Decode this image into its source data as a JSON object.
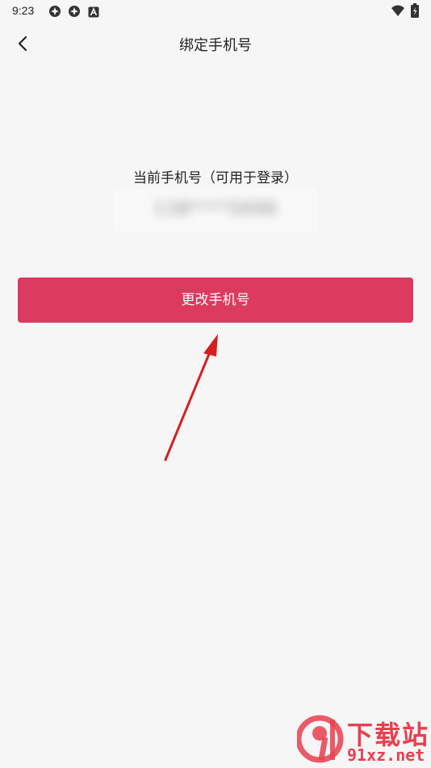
{
  "status_bar": {
    "time": "9:23",
    "icons": [
      "app-notification-icon",
      "app-notification-icon",
      "a-notification-icon",
      "wifi-icon",
      "battery-icon"
    ]
  },
  "nav": {
    "title": "绑定手机号",
    "back_icon": "chevron-left-icon"
  },
  "phone": {
    "label": "当前手机号（可用于登录）",
    "value": "138****5698"
  },
  "actions": {
    "change_phone_label": "更改手机号"
  },
  "watermark": {
    "cn": "下载站",
    "en": "91xz.net"
  },
  "colors": {
    "background": "#f6f6f6",
    "primary": "#dc3a5f",
    "annotation_arrow": "#d42020",
    "watermark": "#e8404f"
  }
}
